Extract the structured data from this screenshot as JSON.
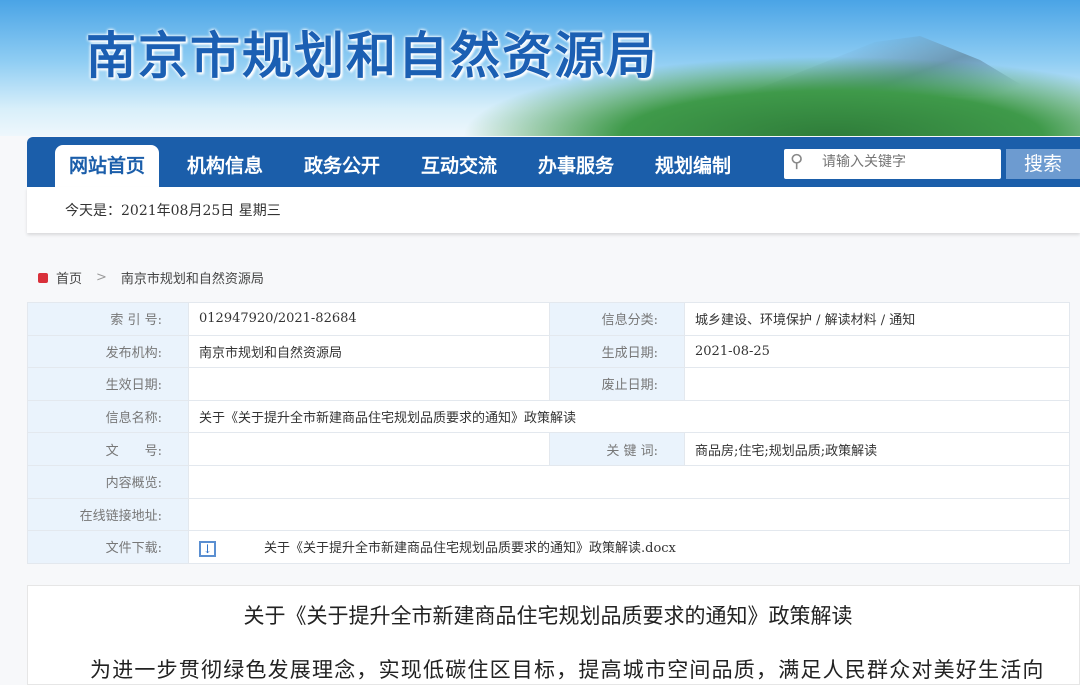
{
  "header": {
    "site_title": "南京市规划和自然资源局"
  },
  "nav": {
    "items": [
      "网站首页",
      "机构信息",
      "政务公开",
      "互动交流",
      "办事服务",
      "规划编制"
    ],
    "active": 0
  },
  "search": {
    "placeholder": "请输入关键字",
    "button": "搜索",
    "icon": "search-icon"
  },
  "datebar": {
    "text": "今天是：2021年08月25日 星期三"
  },
  "breadcrumb": {
    "home": "首页",
    "sep": ">",
    "current": "南京市规划和自然资源局"
  },
  "meta": {
    "index_label": "索 引 号:",
    "index_value": "012947920/2021-82684",
    "category_label": "信息分类:",
    "category_value": "城乡建设、环境保护 / 解读材料 / 通知",
    "publisher_label": "发布机构:",
    "publisher_value": "南京市规划和自然资源局",
    "created_label": "生成日期:",
    "created_value": "2021-08-25",
    "effective_label": "生效日期:",
    "abolish_label": "废止日期:",
    "name_label": "信息名称:",
    "name_value": "关于《关于提升全市新建商品住宅规划品质要求的通知》政策解读",
    "docno_label": "文　　号:",
    "keywords_label": "关 键 词:",
    "keywords_value": "商品房;住宅;规划品质;政策解读",
    "summary_label": "内容概览:",
    "link_label": "在线链接地址:",
    "download_label": "文件下载:",
    "download_file": "关于《关于提升全市新建商品住宅规划品质要求的通知》政策解读.docx"
  },
  "article": {
    "title": "关于《关于提升全市新建商品住宅规划品质要求的通知》政策解读",
    "paragraph": "为进一步贯彻绿色发展理念，实现低碳住区目标，提高城市空间品质，满足人民群众对美好生活向"
  },
  "colors": {
    "nav": "#1b5eaa",
    "label_bg": "#eaf3fc",
    "accent_red": "#d9303a"
  }
}
